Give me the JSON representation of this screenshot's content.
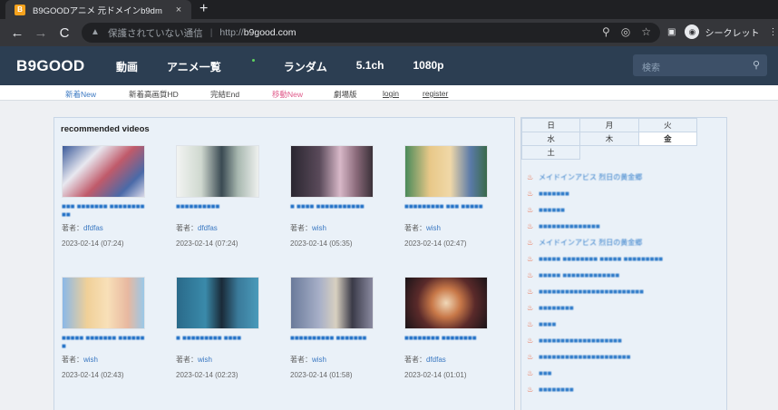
{
  "browser": {
    "tab_title": "B9GOODアニメ 元ドメインb9dm",
    "tab_close": "×",
    "new_tab": "+",
    "back": "←",
    "forward": "→",
    "reload": "C",
    "security_text": "保護されていない通信",
    "url_scheme": "http://",
    "url_host": "b9good.com",
    "incognito_label": "シークレット",
    "colors": {
      "tabbar": "#1f2023",
      "toolbar": "#35363a",
      "omnibox": "#202124"
    }
  },
  "site": {
    "logo": "B9GOOD",
    "nav": [
      "動画",
      "アニメ一覧",
      "ランダム",
      "5.1ch",
      "1080p"
    ],
    "search_placeholder": "検索",
    "subnav": [
      "新着New",
      "新着高画質HD",
      "完結End",
      "移動New",
      "劇場版",
      "login",
      "register"
    ],
    "colors": {
      "header": "#2c3e52",
      "accent": "#3a78c2"
    }
  },
  "recommended": {
    "title": "recommended videos",
    "author_label": "著者：",
    "videos": [
      {
        "title": "■■■ ■■■■■■■ ■■■■■■■■■■",
        "author": "dfdfas",
        "date": "2023-02-14 (07:24)"
      },
      {
        "title": "■■■■■■■■■■",
        "author": "dfdfas",
        "date": "2023-02-14 (07:24)"
      },
      {
        "title": "■ ■■■■ ■■■■■■■■■■■",
        "author": "wish",
        "date": "2023-02-14 (05:35)"
      },
      {
        "title": "■■■■■■■■■ ■■■ ■■■■■",
        "author": "wish",
        "date": "2023-02-14 (02:47)"
      },
      {
        "title": "■■■■■ ■■■■■■■ ■■■■■■■",
        "author": "wish",
        "date": "2023-02-14 (02:43)"
      },
      {
        "title": "■ ■■■■■■■■■ ■■■■",
        "author": "wish",
        "date": "2023-02-14 (02:23)"
      },
      {
        "title": "■■■■■■■■■■ ■■■■■■■",
        "author": "wish",
        "date": "2023-02-14 (01:58)"
      },
      {
        "title": "■■■■■■■■ ■■■■■■■■",
        "author": "dfdfas",
        "date": "2023-02-14 (01:01)"
      }
    ]
  },
  "sidebar": {
    "weekdays": [
      "日",
      "月",
      "火",
      "水",
      "木",
      "金",
      "土"
    ],
    "active_day": "金",
    "items": [
      "メイドインアビス 烈日の黄金郷",
      "■■■■■■■",
      "■■■■■■",
      "■■■■■■■■■■■■■■",
      "メイドインアビス 烈日の黄金郷",
      "■■■■■ ■■■■■■■■ ■■■■■ ■■■■■■■■■",
      "■■■■■ ■■■■■■■■■■■■■",
      "■■■■■■■■■■■■■■■■■■■■■■■■",
      "■■■■■■■■",
      "■■■■",
      "■■■■■■■■■■■■■■■■■■■",
      "■■■■■■■■■■■■■■■■■■■■■",
      "■■■",
      "■■■■■■■■"
    ]
  }
}
